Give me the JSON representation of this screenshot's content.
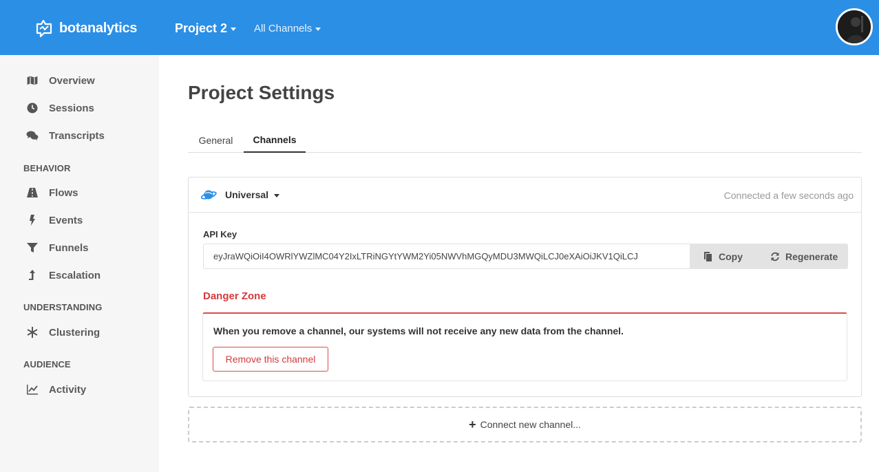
{
  "app": {
    "logo_text": "botanalytics"
  },
  "topbar": {
    "project_label": "Project 2",
    "channels_label": "All Channels"
  },
  "sidebar": {
    "main_items": [
      {
        "label": "Overview",
        "icon": "map-icon"
      },
      {
        "label": "Sessions",
        "icon": "clock-icon"
      },
      {
        "label": "Transcripts",
        "icon": "comments-icon"
      }
    ],
    "behavior_title": "BEHAVIOR",
    "behavior_items": [
      {
        "label": "Flows",
        "icon": "road-icon"
      },
      {
        "label": "Events",
        "icon": "bolt-icon"
      },
      {
        "label": "Funnels",
        "icon": "filter-icon"
      },
      {
        "label": "Escalation",
        "icon": "level-up-icon"
      }
    ],
    "understanding_title": "UNDERSTANDING",
    "understanding_items": [
      {
        "label": "Clustering",
        "icon": "asterisk-icon"
      }
    ],
    "audience_title": "AUDIENCE",
    "audience_items": [
      {
        "label": "Activity",
        "icon": "line-chart-icon"
      }
    ]
  },
  "page": {
    "title": "Project Settings",
    "tabs": [
      {
        "label": "General",
        "active": false
      },
      {
        "label": "Channels",
        "active": true
      }
    ]
  },
  "channel": {
    "name": "Universal",
    "status": "Connected a few seconds ago",
    "api_key_label": "API Key",
    "api_key_value": "eyJraWQiOiI4OWRlYWZlMC04Y2IxLTRiNGYtYWM2Yi05NWVhMGQyMDU3MWQiLCJ0eXAiOiJKV1QiLCJ",
    "copy_label": "Copy",
    "regenerate_label": "Regenerate",
    "danger_title": "Danger Zone",
    "danger_message": "When you remove a channel, our systems will not receive any new data from the channel.",
    "remove_label": "Remove this channel"
  },
  "connect_new_label": "Connect new channel...",
  "colors": {
    "topbar": "#2b8fe6",
    "danger": "#d33a3a",
    "sidebar_bg": "#f6f6f6"
  }
}
